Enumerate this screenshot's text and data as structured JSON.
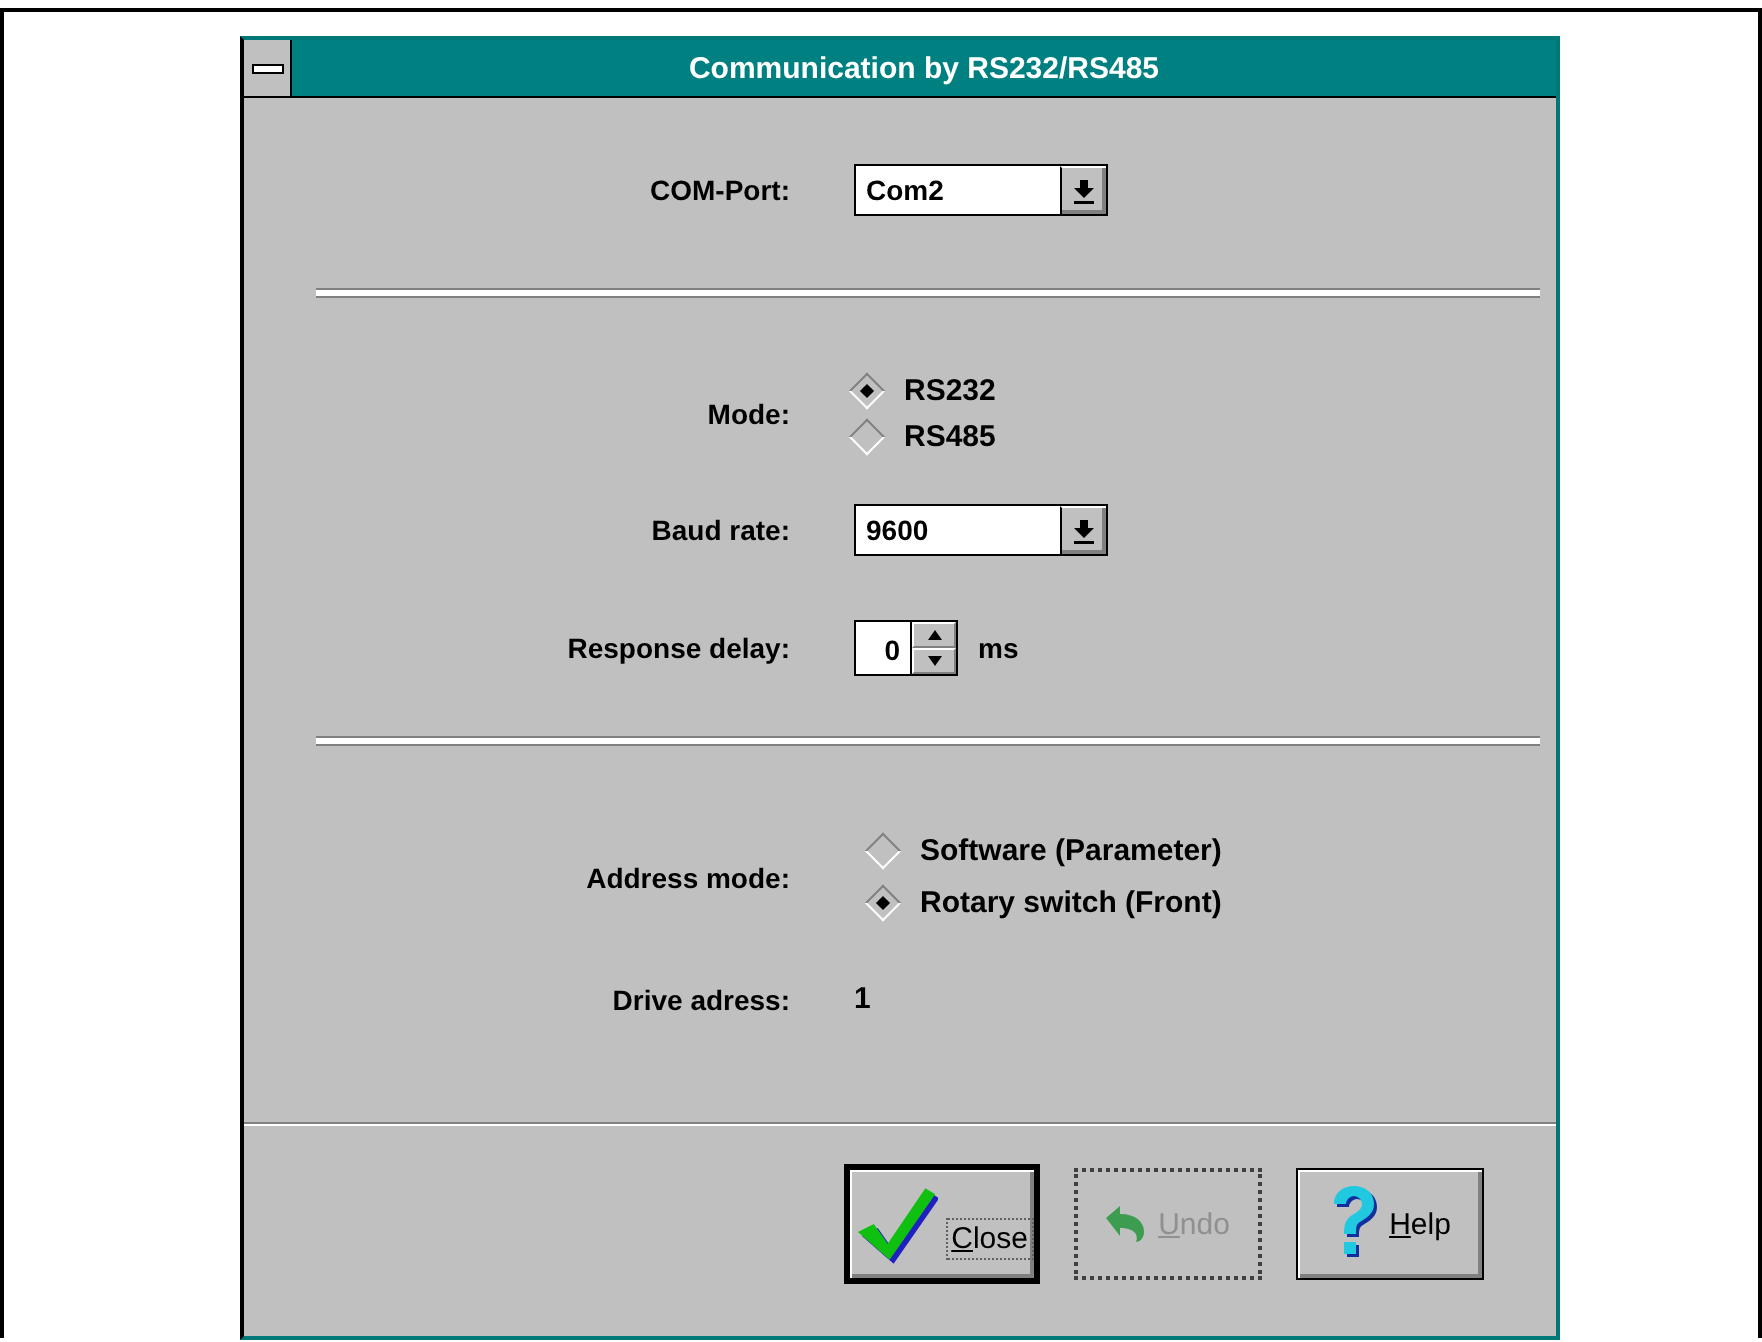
{
  "window": {
    "title": "Communication by RS232/RS485"
  },
  "com_port": {
    "label": "COM-Port:",
    "value": "Com2"
  },
  "mode": {
    "label": "Mode:",
    "options": [
      {
        "label": "RS232",
        "selected": true
      },
      {
        "label": "RS485",
        "selected": false
      }
    ]
  },
  "baud_rate": {
    "label": "Baud rate:",
    "value": "9600"
  },
  "response_delay": {
    "label": "Response delay:",
    "value": "0",
    "unit": "ms"
  },
  "address_mode": {
    "label": "Address mode:",
    "options": [
      {
        "label": "Software (Parameter)",
        "selected": false
      },
      {
        "label": "Rotary switch (Front)",
        "selected": true
      }
    ]
  },
  "drive_address": {
    "label": "Drive adress:",
    "value": "1"
  },
  "buttons": [
    {
      "label": "Close",
      "kind": "close",
      "default": true,
      "disabled": false
    },
    {
      "label": "Undo",
      "kind": "undo",
      "default": false,
      "disabled": true
    },
    {
      "label": "Help",
      "kind": "help",
      "default": false,
      "disabled": false
    }
  ]
}
